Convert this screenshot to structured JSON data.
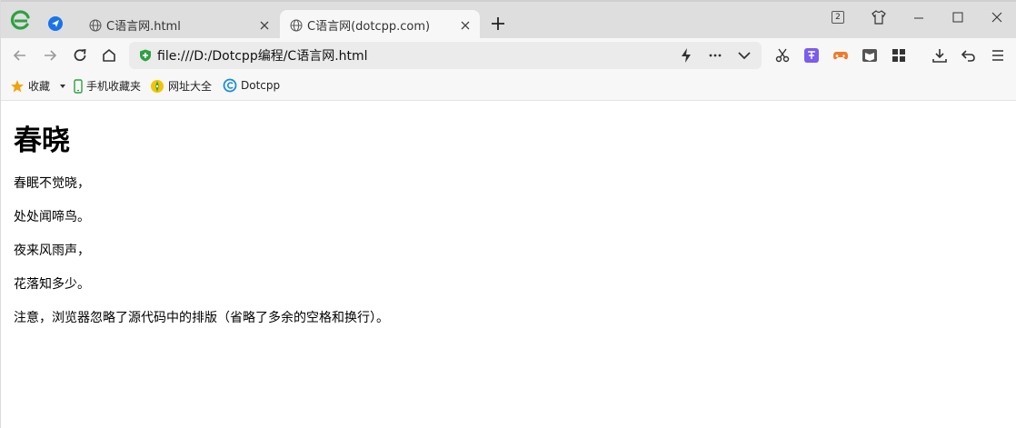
{
  "tabs": [
    {
      "title": "C语言网.html",
      "active": false
    },
    {
      "title": "C语言网(dotcpp.com)",
      "active": true
    }
  ],
  "tab_count": "2",
  "address": {
    "url": "file:///D:/Dotcpp编程/C语言网.html"
  },
  "bookmarks": {
    "favorites_label": "收藏",
    "mobile_label": "手机收藏夹",
    "sites_label": "网址大全",
    "dotcpp_label": "Dotcpp"
  },
  "page": {
    "heading": "春晓",
    "lines": [
      "春眠不觉晓，",
      "处处闻啼鸟。",
      "夜来风雨声，",
      "花落知多少。"
    ],
    "note": "注意，浏览器忽略了源代码中的排版（省略了多余的空格和换行）。"
  },
  "colors": {
    "accent": "#2ea043",
    "star": "#f0a30a",
    "translate": "#7a5cf0",
    "game": "#f07a28"
  }
}
